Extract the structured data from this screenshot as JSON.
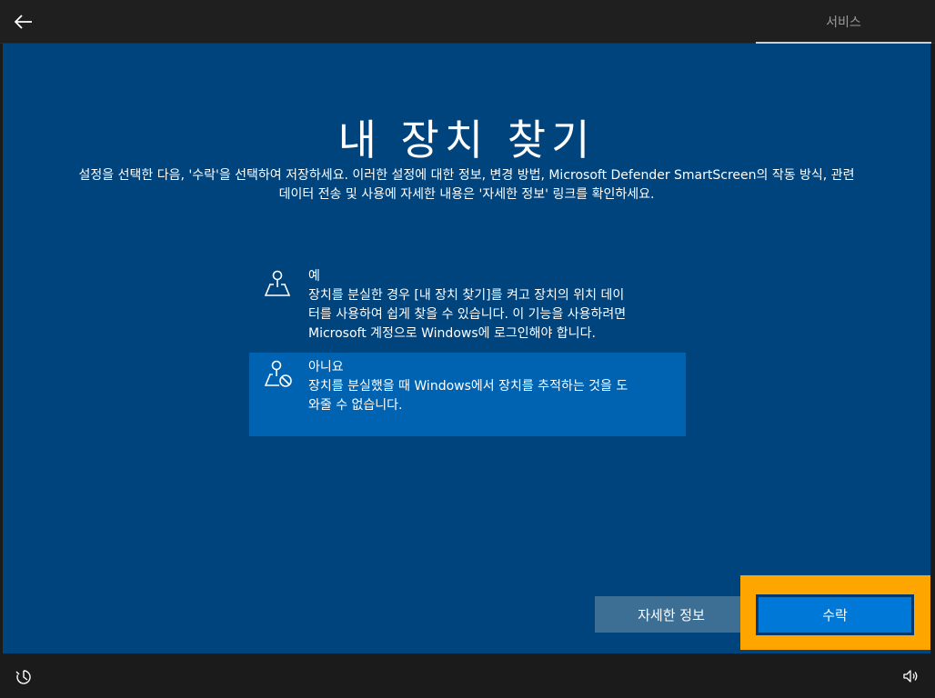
{
  "header": {
    "back_icon": "back-arrow-icon",
    "tab_label": "서비스"
  },
  "main": {
    "title": "내 장치 찾기",
    "description_line1": "설정을 선택한 다음, '수락'을 선택하여 저장하세요. 이러한 설정에 대한 정보, 변경 방법, Microsoft Defender SmartScreen의 작동 방식, 관련",
    "description_line2": "데이터 전송 및 사용에 자세한 내용은 '자세한 정보' 링크를 확인하세요.",
    "options": [
      {
        "title": "예",
        "line1": "장치를 분실한 경우 [내 장치 찾기]를 켜고 장치의 위치 데이",
        "line2": "터를 사용하여 쉽게 찾을 수 있습니다. 이 기능을 사용하려면",
        "line3": "Microsoft 계정으로 Windows에 로그인해야 합니다.",
        "icon": "location-pin-map-icon",
        "selected": false
      },
      {
        "title": "아니요",
        "line1": "장치를 분실했을 때 Windows에서 장치를 추적하는 것을 도",
        "line2": "와줄 수 없습니다.",
        "icon": "location-off-icon",
        "selected": true
      }
    ]
  },
  "buttons": {
    "info_label": "자세한 정보",
    "accept_label": "수락"
  },
  "footer": {
    "ease_icon": "ease-of-access-icon",
    "volume_icon": "volume-icon"
  },
  "colors": {
    "background": "#00447d",
    "selected_option": "#0063b1",
    "accept_button": "#0078d7",
    "highlight": "#ffa500"
  }
}
